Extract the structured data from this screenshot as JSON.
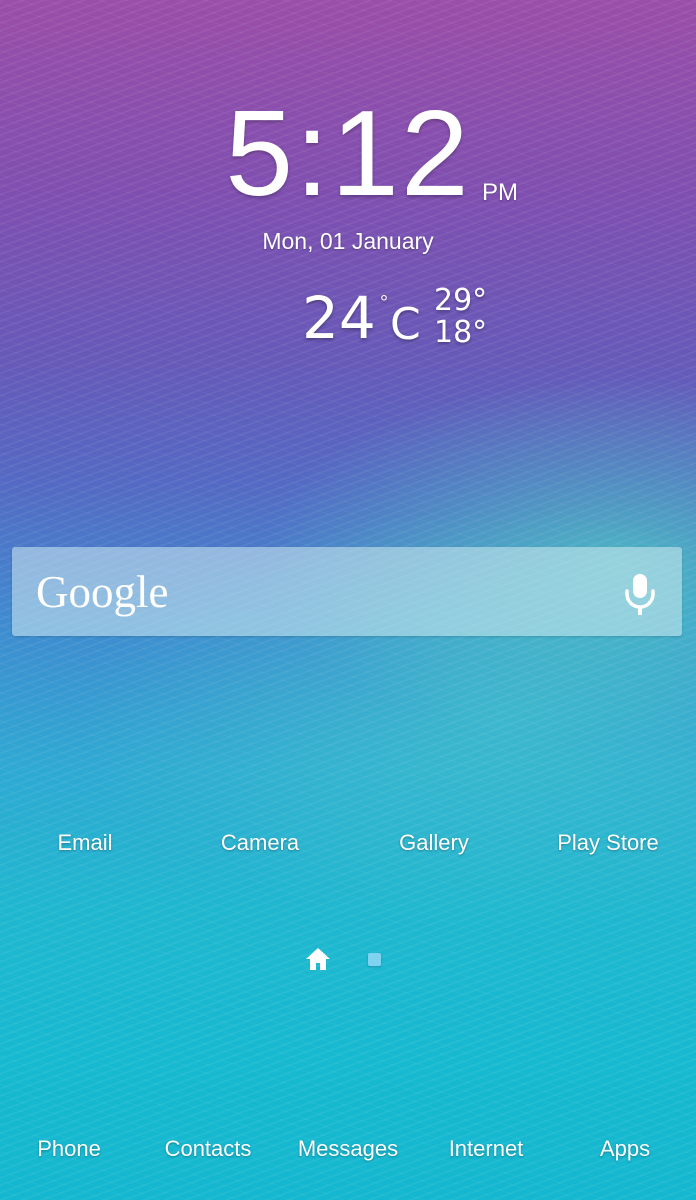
{
  "clock": {
    "time": "5:12",
    "ampm": "PM",
    "date": "Mon, 01 January"
  },
  "weather": {
    "temperature": "24",
    "degree": "°",
    "unit": "C",
    "high": "29°",
    "low": "18°"
  },
  "search_widget": {
    "logo": "Google",
    "mic_icon": "microphone-icon"
  },
  "home_apps": [
    {
      "label": "Email"
    },
    {
      "label": "Camera"
    },
    {
      "label": "Gallery"
    },
    {
      "label": "Play Store"
    }
  ],
  "pager": {
    "home_icon": "home-icon",
    "pages": 1,
    "active_color": "#7fd3f0"
  },
  "dock": [
    {
      "label": "Phone"
    },
    {
      "label": "Contacts"
    },
    {
      "label": "Messages"
    },
    {
      "label": "Internet"
    },
    {
      "label": "Apps"
    }
  ]
}
